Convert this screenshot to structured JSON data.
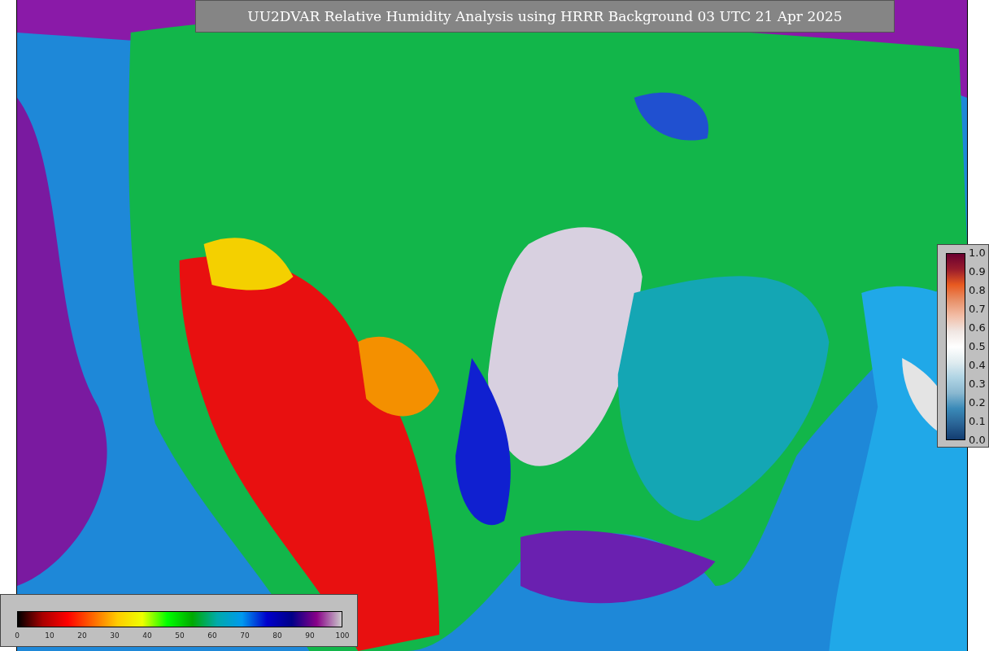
{
  "title": "UU2DVAR Relative Humidity Analysis using HRRR Background 03 UTC 21 Apr 2025",
  "humidity_legend": {
    "ticks": [
      "0",
      "10",
      "20",
      "30",
      "40",
      "50",
      "60",
      "70",
      "80",
      "90",
      "100"
    ]
  },
  "ratio_legend": {
    "ticks": [
      "1.0",
      "0.9",
      "0.8",
      "0.7",
      "0.6",
      "0.5",
      "0.4",
      "0.3",
      "0.2",
      "0.1",
      "0.0"
    ]
  }
}
